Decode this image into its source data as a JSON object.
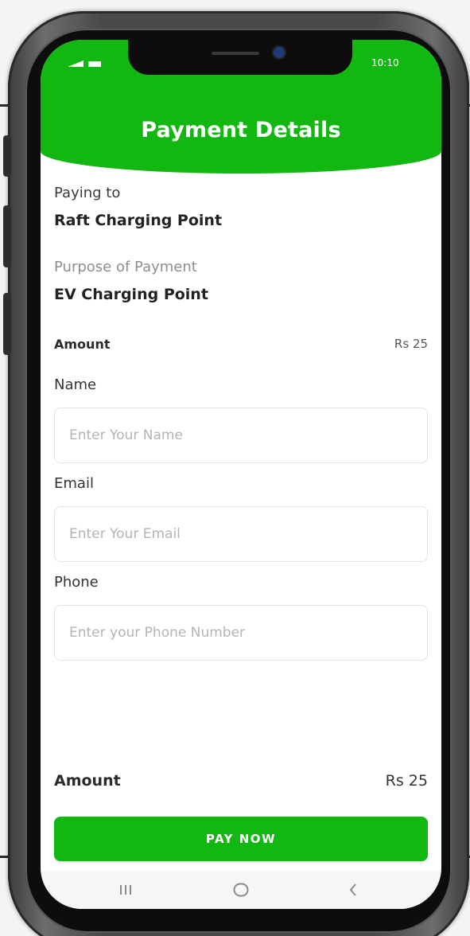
{
  "status_bar": {
    "time": "10:10",
    "signal_icon": "signal-icon",
    "battery_icon": "battery-icon"
  },
  "header": {
    "title": "Payment Details",
    "color": "#13b711"
  },
  "details": {
    "paying_to_label": "Paying to",
    "paying_to_value": "Raft Charging Point",
    "purpose_label": "Purpose of Payment",
    "purpose_value": "EV Charging Point",
    "amount_label": "Amount",
    "amount_value": "Rs 25"
  },
  "form": {
    "name_label": "Name",
    "name_placeholder": "Enter Your Name",
    "email_label": "Email",
    "email_placeholder": "Enter Your Email",
    "phone_label": "Phone",
    "phone_placeholder": "Enter your Phone Number"
  },
  "footer": {
    "amount_label": "Amount",
    "amount_value": "Rs 25",
    "pay_button_label": "PAY NOW",
    "button_color": "#13b711"
  },
  "navigation": {
    "recent_icon": "recent-apps-icon",
    "home_icon": "home-icon",
    "back_icon": "back-icon"
  }
}
